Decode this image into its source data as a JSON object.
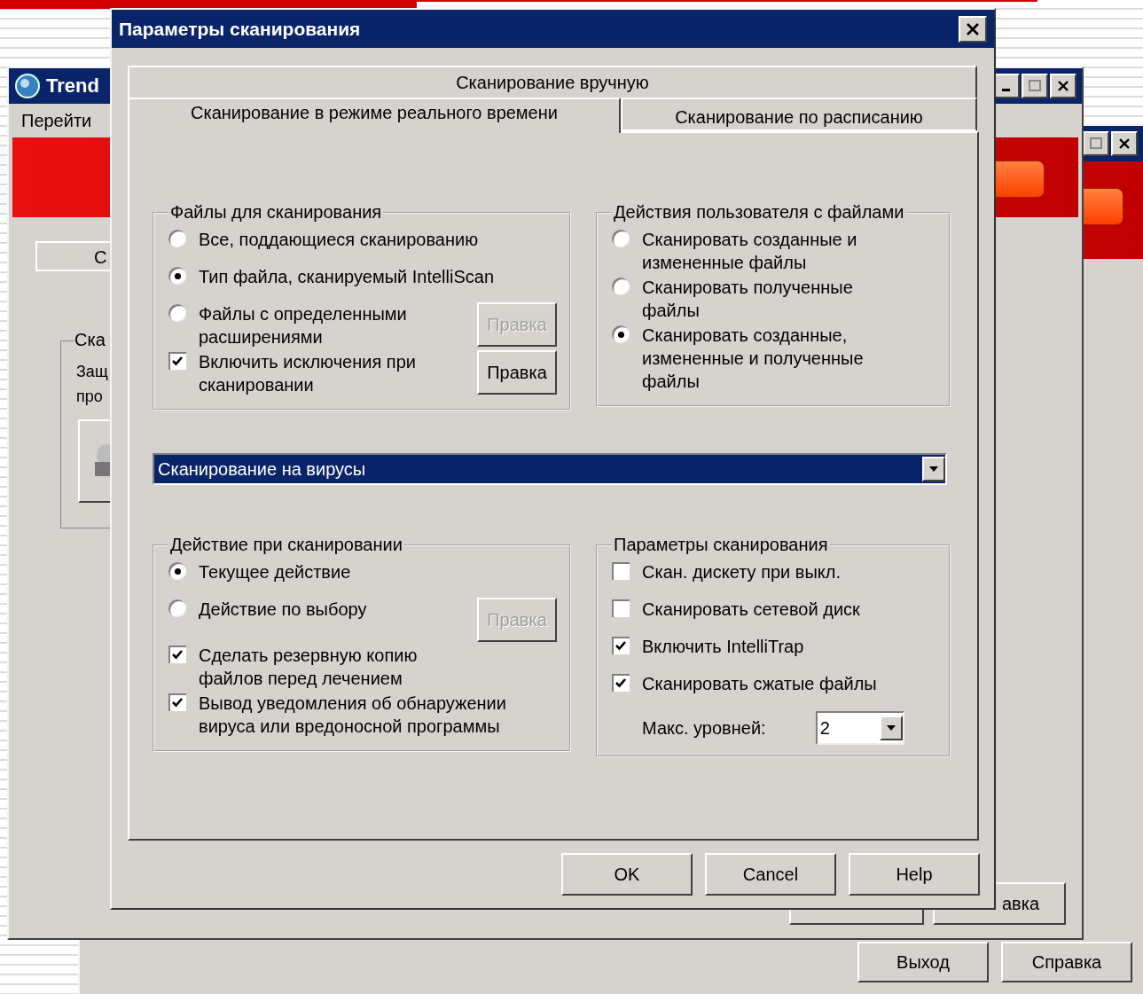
{
  "background_windows": [
    {
      "title": "Trend",
      "menu": [
        "Перейти"
      ],
      "tab": "С",
      "group_title": "Ска",
      "group_text": "Защ\nпро",
      "buttons": [
        "авка"
      ]
    },
    {
      "buttons": [
        "Выход",
        "Справка"
      ]
    }
  ],
  "dialog": {
    "title": "Параметры сканирования",
    "tab_rows": [
      [
        {
          "label": "Сканирование вручную",
          "selected": false
        }
      ],
      [
        {
          "label": "Сканирование в режиме реального времени",
          "selected": true
        },
        {
          "label": "Сканирование по расписанию",
          "selected": false
        }
      ]
    ],
    "groups": [
      {
        "title": "Файлы для сканирования",
        "options": [
          {
            "kind": "radio",
            "label": "Все, поддающиеся сканированию",
            "selected": false
          },
          {
            "kind": "radio",
            "label": "Тип файла, сканируемый IntelliScan",
            "selected": true
          },
          {
            "kind": "radio",
            "label": "Файлы с определенными\nрасширениями",
            "selected": false,
            "button": {
              "label": "Правка",
              "disabled": true
            }
          },
          {
            "kind": "checkbox",
            "label": "Включить исключения при\nсканировании",
            "checked": true,
            "button": {
              "label": "Правка",
              "disabled": false
            }
          }
        ]
      },
      {
        "title": "Действия пользователя с файлами",
        "options": [
          {
            "kind": "radio",
            "label": "Сканировать созданные и\nизмененные файлы",
            "selected": false
          },
          {
            "kind": "radio",
            "label": "Сканировать полученные\nфайлы",
            "selected": false
          },
          {
            "kind": "radio",
            "label": "Сканировать созданные,\nизмененные и полученные\nфайлы",
            "selected": true
          }
        ]
      }
    ],
    "scan_type": {
      "value": "Сканирование на вирусы"
    },
    "groups_lower": [
      {
        "title": "Действие при сканировании",
        "options": [
          {
            "kind": "radio",
            "label": "Текущее действие",
            "selected": true
          },
          {
            "kind": "radio",
            "label": "Действие по выбору",
            "selected": false,
            "button": {
              "label": "Правка",
              "disabled": true
            }
          },
          {
            "kind": "checkbox",
            "label": "Сделать резервную копию\nфайлов перед лечением",
            "checked": true
          },
          {
            "kind": "checkbox",
            "label": "Вывод уведомления об обнаружении\nвируса или вредоносной программы",
            "checked": true
          }
        ]
      },
      {
        "title": "Параметры сканирования",
        "options": [
          {
            "kind": "checkbox",
            "label": "Скан. дискету при выкл.",
            "checked": false
          },
          {
            "kind": "checkbox",
            "label": "Сканировать сетевой диск",
            "checked": false
          },
          {
            "kind": "checkbox",
            "label": "Включить IntelliTrap",
            "checked": true
          },
          {
            "kind": "checkbox",
            "label": "Сканировать сжатые файлы",
            "checked": true
          }
        ],
        "max_levels": {
          "label": "Макс. уровней:",
          "value": "2"
        }
      }
    ],
    "buttons": [
      "OK",
      "Cancel",
      "Help"
    ]
  }
}
